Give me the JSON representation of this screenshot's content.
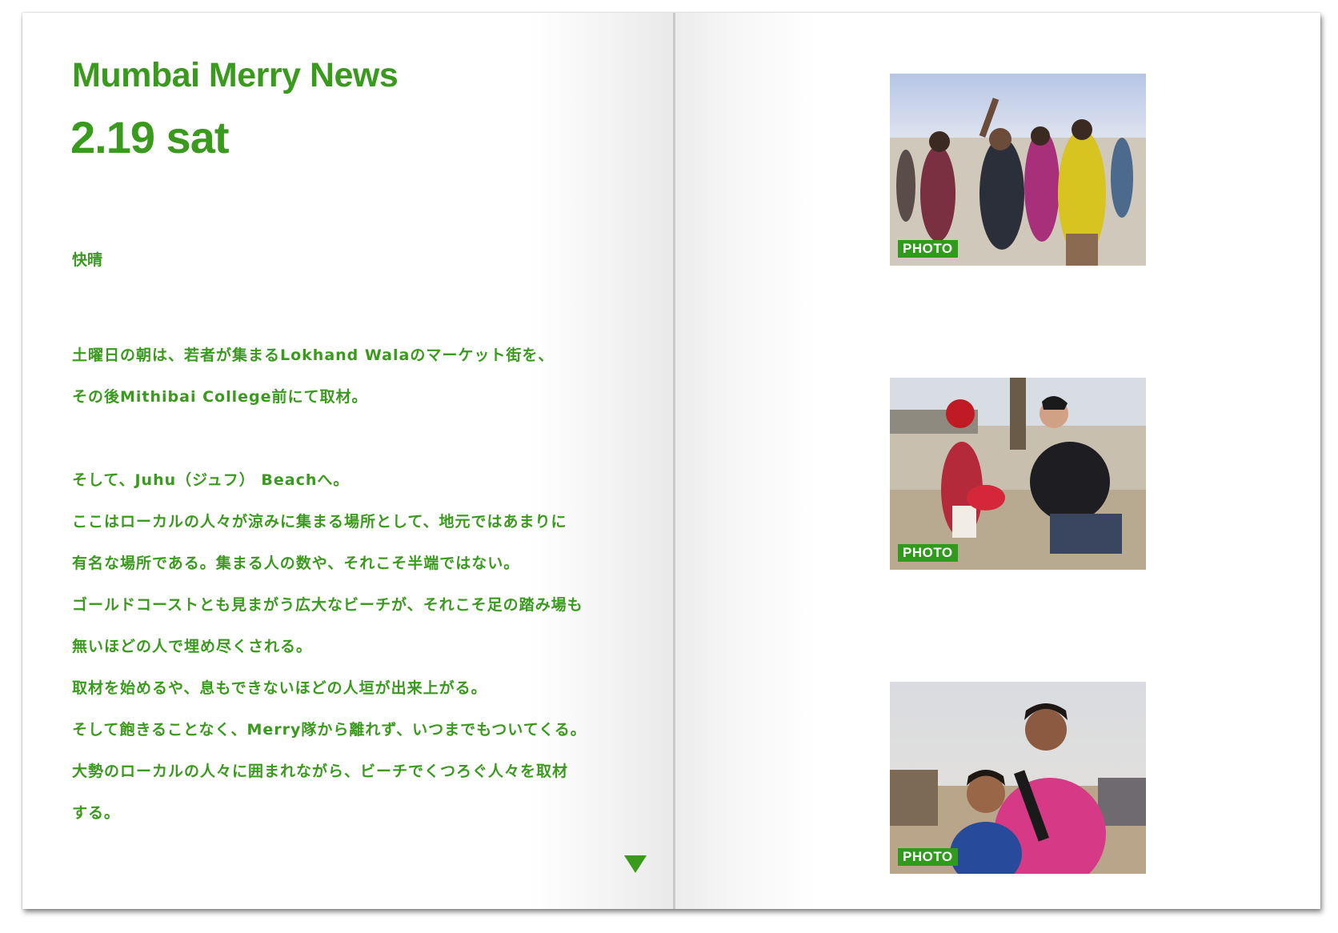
{
  "article": {
    "title": "Mumbai Merry News",
    "date": "2.19 sat",
    "weather": "快晴",
    "paragraph1": [
      "土曜日の朝は、若者が集まるLokhand Walaのマーケット街を、",
      "その後Mithibai College前にて取材。"
    ],
    "paragraph2": [
      "そして、Juhu（ジュフ） Beachへ。",
      "ここはローカルの人々が涼みに集まる場所として、地元ではあまりに",
      "有名な場所である。集まる人の数や、それこそ半端ではない。",
      "ゴールドコーストとも見まがう広大なビーチが、それこそ足の踏み場も",
      "無いほどの人で埋め尽くされる。",
      "取材を始めるや、息もできないほどの人垣が出来上がる。",
      "そして飽きることなく、Merry隊から離れず、いつまでもついてくる。",
      "大勢のローカルの人々に囲まれながら、ビーチでくつろぐ人々を取材",
      "する。"
    ],
    "next_icon": "down-triangle-icon"
  },
  "photos": [
    {
      "badge": "PHOTO",
      "scene": "dancing-crowd-on-beach"
    },
    {
      "badge": "PHOTO",
      "scene": "man-photographing-child-on-beach"
    },
    {
      "badge": "PHOTO",
      "scene": "two-smiling-girls-on-beach"
    }
  ],
  "colors": {
    "text_green": "#3a9a1d",
    "badge_green": "#2f9a1b"
  }
}
